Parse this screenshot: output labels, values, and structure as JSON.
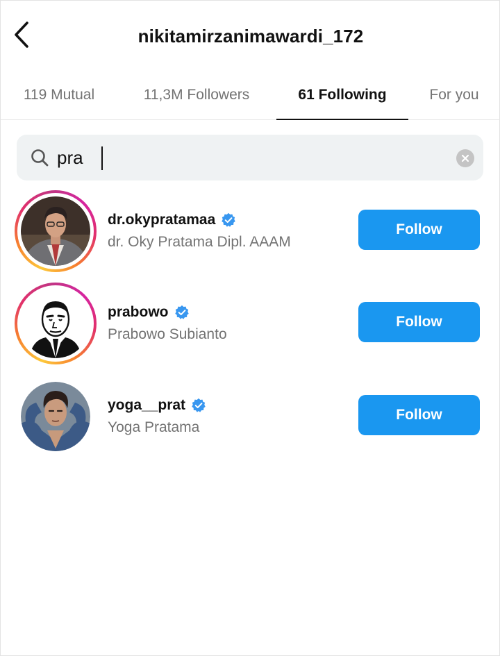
{
  "header": {
    "title": "nikitamirzanimawardi_172",
    "back_icon": "chevron-left-icon"
  },
  "tabs": [
    {
      "label": "119 Mutual",
      "active": false
    },
    {
      "label": "11,3M Followers",
      "active": false
    },
    {
      "label": "61 Following",
      "active": true
    },
    {
      "label": "For you",
      "active": false
    }
  ],
  "search": {
    "value": "pra",
    "icon": "search-icon",
    "clear_icon": "clear-icon"
  },
  "accounts": [
    {
      "username": "dr.okypratamaa",
      "full_name": "dr. Oky Pratama Dipl. AAAM",
      "verified": true,
      "has_story": true,
      "button_label": "Follow"
    },
    {
      "username": "prabowo",
      "full_name": "Prabowo Subianto",
      "verified": true,
      "has_story": true,
      "button_label": "Follow"
    },
    {
      "username": "yoga__prat",
      "full_name": "Yoga Pratama",
      "verified": true,
      "has_story": false,
      "button_label": "Follow"
    }
  ],
  "colors": {
    "accent": "#1a97f0",
    "verified": "#3897f0",
    "secondary_text": "#737373"
  }
}
